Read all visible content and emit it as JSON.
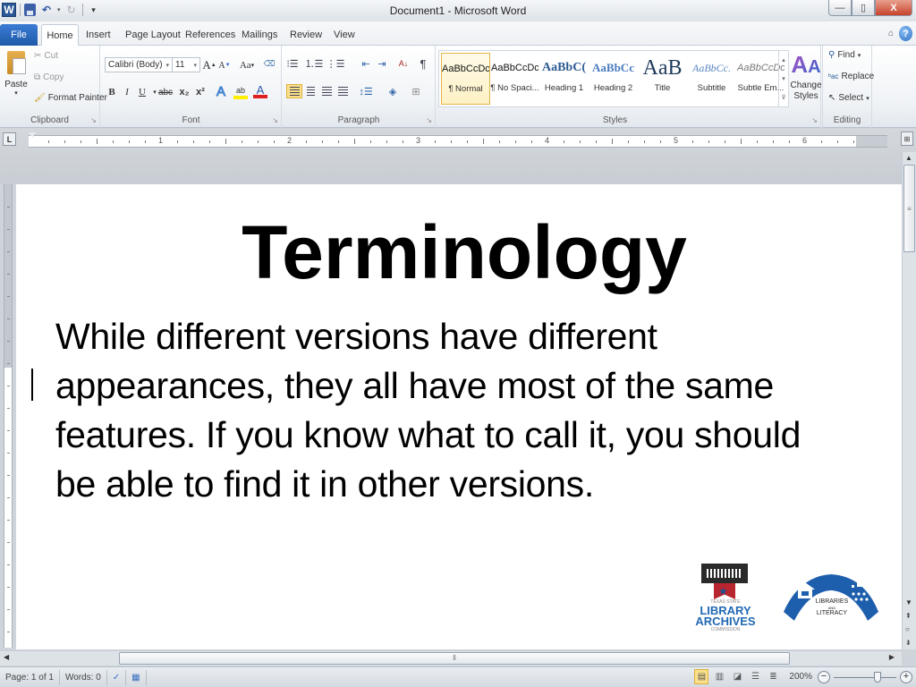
{
  "window": {
    "title": "Document1 - Microsoft Word",
    "controls": {
      "minimize": "—",
      "restore": "▯",
      "close": "X"
    }
  },
  "quick_access": {
    "icons": [
      "word-logo-icon",
      "save-icon",
      "undo-icon",
      "redo-icon",
      "customize-icon"
    ],
    "word_logo_glyph": "W",
    "undo_glyph": "↶",
    "redo_glyph": "↻",
    "customize_glyph": "▾"
  },
  "tabs": [
    {
      "label": "File"
    },
    {
      "label": "Home"
    },
    {
      "label": "Insert"
    },
    {
      "label": "Page Layout"
    },
    {
      "label": "References"
    },
    {
      "label": "Mailings"
    },
    {
      "label": "Review"
    },
    {
      "label": "View"
    }
  ],
  "tab_right": {
    "collapse_glyph": "⌂",
    "help_glyph": "?"
  },
  "ribbon": {
    "clipboard": {
      "label": "Clipboard",
      "paste": "Paste",
      "cut": "Cut",
      "copy": "Copy",
      "format_painter": "Format Painter"
    },
    "font": {
      "label": "Font",
      "font_name": "Calibri (Body)",
      "font_size": "11",
      "grow": "A",
      "shrink": "A",
      "change_case": "Aa",
      "bold": "B",
      "italic": "I",
      "underline": "U",
      "strikethrough": "abc",
      "subscript": "x₂",
      "superscript": "x²",
      "text_effects": "A",
      "highlight": "ab",
      "font_color": "A",
      "font_color_value": "#e02020",
      "highlight_color_value": "#ffee00"
    },
    "paragraph": {
      "label": "Paragraph",
      "show_marks": "¶",
      "sort": "A↓"
    },
    "styles": {
      "label": "Styles",
      "items": [
        {
          "sample": "AaBbCcDc",
          "name": "¶ Normal",
          "active": true
        },
        {
          "sample": "AaBbCcDc",
          "name": "¶ No Spaci...",
          "active": false
        },
        {
          "sample": "AaBbC(",
          "name": "Heading 1",
          "active": false
        },
        {
          "sample": "AaBbCc",
          "name": "Heading 2",
          "active": false
        },
        {
          "sample": "AaB",
          "name": "Title",
          "active": false
        },
        {
          "sample": "AaBbCc.",
          "name": "Subtitle",
          "active": false
        },
        {
          "sample": "AaBbCcDc",
          "name": "Subtle Em...",
          "active": false
        }
      ],
      "change_styles": "Change Styles",
      "change_styles_glyph": "A"
    },
    "editing": {
      "label": "Editing",
      "find": "Find",
      "replace": "Replace",
      "select": "Select"
    }
  },
  "ruler": {
    "tab_selector_glyph": "L",
    "numbers": [
      "1",
      "2",
      "3",
      "4",
      "5",
      "6"
    ],
    "view_ruler_glyph": "⊞"
  },
  "document": {
    "title": "Terminology",
    "body": "While different versions have different appearances, they all have most of the same features. If you know what to call it, you should be able to find it in other versions."
  },
  "logos": {
    "tslac": {
      "top_text": "TEXAS STATE",
      "line1": "LIBRARY",
      "line2": "ARCHIVES",
      "bottom_text": "COMMISSION",
      "blue": "#2069b3",
      "red": "#b9252f"
    },
    "literacy": {
      "line1": "LIBRARIES",
      "line2": "AND",
      "line3": "LITERACY",
      "blue": "#1e5fad"
    }
  },
  "statusbar": {
    "page": "Page: 1 of 1",
    "words": "Words: 0",
    "zoom_level": "200%",
    "zoom_minus": "−",
    "zoom_plus": "+",
    "zoom_fraction": 0.72
  },
  "scrollbars": {
    "up": "▲",
    "down": "▼",
    "prev_page": "⇞",
    "select_browse": "○",
    "next_page": "⇟",
    "left": "◀",
    "right": "▶",
    "grip": "≡"
  }
}
